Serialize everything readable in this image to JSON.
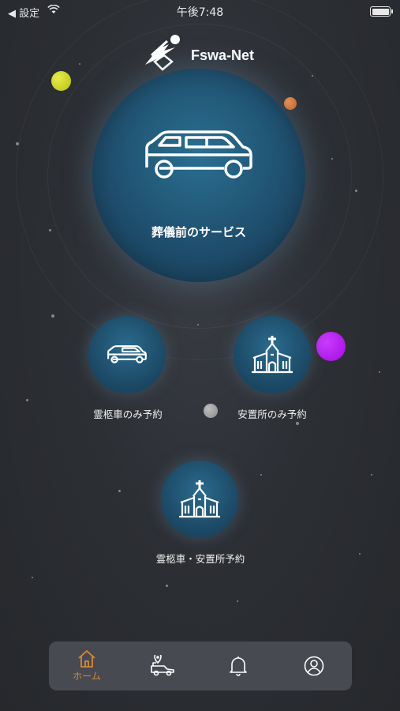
{
  "status_bar": {
    "back_label": "◀ 設定",
    "time": "午後7:48"
  },
  "brand": {
    "name": "Fswa-Net"
  },
  "main_service": {
    "label": "葬儀前のサービス"
  },
  "options": [
    {
      "label": "霊柩車のみ予約"
    },
    {
      "label": "安置所のみ予約"
    },
    {
      "label": "霊柩車・安置所予約"
    }
  ],
  "tab_bar": {
    "tabs": [
      {
        "label": "ホーム"
      }
    ]
  },
  "colors": {
    "accent": "#d9873a",
    "circle": "#1f4f6e",
    "planet_yellow": "#c8d21a",
    "planet_orange": "#d9702a",
    "planet_purple": "#b012e8",
    "planet_gray": "#9a9a9a"
  }
}
